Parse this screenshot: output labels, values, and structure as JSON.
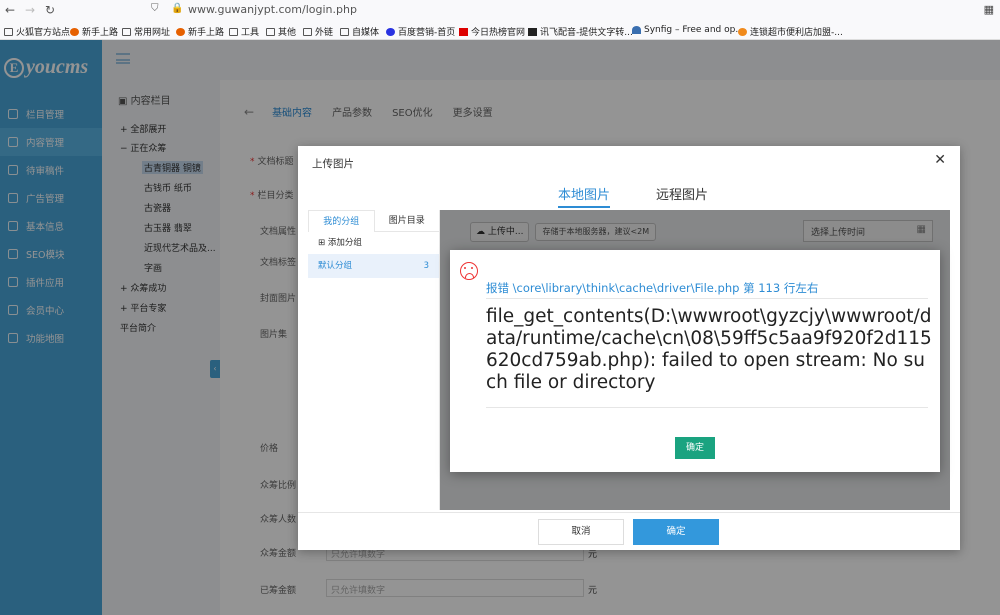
{
  "browser": {
    "url": "www.guwanjypt.com/login.php",
    "bookmarks": [
      {
        "label": "火狐官方站点",
        "icon": "folder-icon"
      },
      {
        "label": "新手上路",
        "icon": "firefox-icon"
      },
      {
        "label": "常用网址",
        "icon": "folder-icon"
      },
      {
        "label": "新手上路",
        "icon": "firefox-icon"
      },
      {
        "label": "工具",
        "icon": "folder-icon"
      },
      {
        "label": "其他",
        "icon": "folder-icon"
      },
      {
        "label": "外链",
        "icon": "folder-icon"
      },
      {
        "label": "自媒体",
        "icon": "folder-icon"
      },
      {
        "label": "百度营销-首页",
        "icon": "baidu-icon"
      },
      {
        "label": "今日热榜官网",
        "icon": "r-icon"
      },
      {
        "label": "讯飞配音-提供文字转...",
        "icon": "xunfei-icon"
      },
      {
        "label": "Synfig – Free and op...",
        "icon": "synfig-icon"
      },
      {
        "label": "连锁超市便利店加盟-...",
        "icon": "e-icon"
      }
    ]
  },
  "app": {
    "logo": "youcms",
    "logo_mark": "E",
    "menu": [
      "栏目管理",
      "内容管理",
      "待审稿件",
      "广告管理",
      "基本信息",
      "SEO模块",
      "插件应用",
      "会员中心",
      "功能地图"
    ],
    "active_menu_index": 1
  },
  "tree": {
    "title": "内容栏目",
    "items": [
      {
        "prefix": "+",
        "label": "全部展开"
      },
      {
        "prefix": "−",
        "label": "正在众筹"
      },
      {
        "prefix": "",
        "label": "古青铜器 铜镜"
      },
      {
        "prefix": "",
        "label": "古钱币 纸币"
      },
      {
        "prefix": "",
        "label": "古瓷器"
      },
      {
        "prefix": "",
        "label": "古玉器 翡翠"
      },
      {
        "prefix": "",
        "label": "近现代艺术品及..."
      },
      {
        "prefix": "",
        "label": "字画"
      },
      {
        "prefix": "+",
        "label": "众筹成功"
      },
      {
        "prefix": "+",
        "label": "平台专家"
      },
      {
        "prefix": "",
        "label": "平台简介"
      }
    ],
    "collapse_glyph": "‹"
  },
  "form": {
    "tabs": [
      "基础内容",
      "产品参数",
      "SEO优化",
      "更多设置"
    ],
    "active_tab_index": 0,
    "labels": {
      "title": "文档标题",
      "column": "栏目分类",
      "attr": "文档属性",
      "title_color": "文档标签",
      "cover": "封面图片",
      "images": "图片集",
      "price": "价格",
      "ratio": "众筹比例",
      "people": "众筹人数",
      "amount": "众筹金额",
      "raised": "已筹金额"
    },
    "placeholder_number": "只允许填数字",
    "unit": "元"
  },
  "upload_dialog": {
    "title": "上传图片",
    "close_glyph": "✕",
    "tabs": [
      "本地图片",
      "远程图片"
    ],
    "active_tab_index": 0,
    "group_tabs": [
      "我的分组",
      "图片目录"
    ],
    "add_group": "添加分组",
    "default_group": "默认分组",
    "default_group_count": "3",
    "upload_button": "上传中...",
    "upload_hint": "存储于本地服务器，建议<2M",
    "time_filter_placeholder": "选择上传时间",
    "cancel": "取消",
    "confirm": "确定"
  },
  "error_dialog": {
    "location": "报错 \\core\\library\\think\\cache\\driver\\File.php 第 113 行左右",
    "message": "file_get_contents(D:\\wwwroot\\gyzcjy\\wwwroot/data/runtime/cache\\cn\\08\\59ff5c5aa9f920f2d115620cd759ab.php): failed to open stream: No such file or directory",
    "confirm": "确定"
  },
  "colors": {
    "sidebar": "#49a5d9",
    "accent": "#2d8cd4",
    "confirm_green": "#1aa380",
    "primary_button": "#3398dc",
    "error_red": "#e33333"
  }
}
